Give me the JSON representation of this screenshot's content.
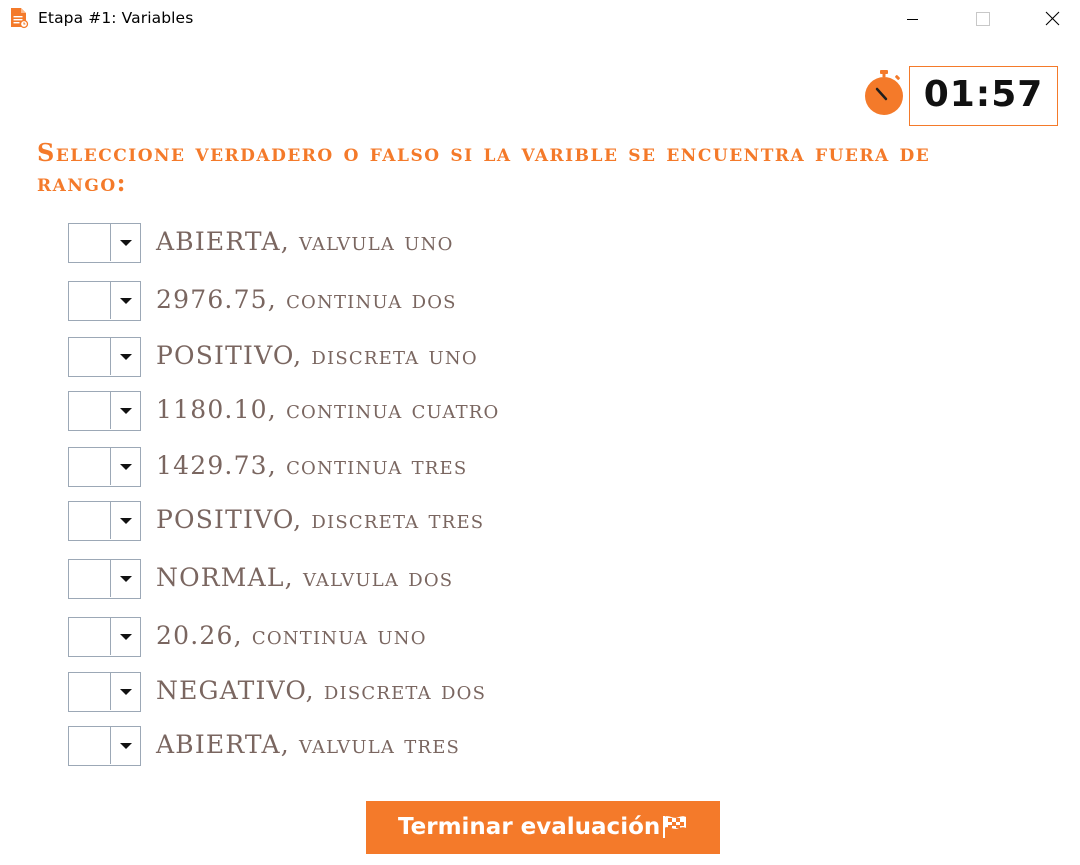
{
  "window": {
    "title": "Etapa #1: Variables"
  },
  "timer": {
    "value": "01:57",
    "icon": "stopwatch-icon"
  },
  "instructions": "Seleccione verdadero o falso si la varible se encuentra fuera de rango:",
  "questions": [
    {
      "label": "ABIERTA, valvula uno",
      "selected": ""
    },
    {
      "label": "2976.75, continua dos",
      "selected": ""
    },
    {
      "label": "POSITIVO, discreta uno",
      "selected": ""
    },
    {
      "label": "1180.10, continua cuatro",
      "selected": ""
    },
    {
      "label": "1429.73, continua tres",
      "selected": ""
    },
    {
      "label": "POSITIVO, discreta tres",
      "selected": ""
    },
    {
      "label": "NORMAL, valvula dos",
      "selected": ""
    },
    {
      "label": "20.26, continua uno",
      "selected": ""
    },
    {
      "label": "NEGATIVO, discreta dos",
      "selected": ""
    },
    {
      "label": "ABIERTA, valvula tres",
      "selected": ""
    }
  ],
  "finish_button": {
    "label": "Terminar evaluación",
    "icon": "checkered-flag-icon"
  },
  "colors": {
    "accent": "#f47a2a",
    "label_text": "#7a6660",
    "select_border": "#9ca8b6"
  }
}
